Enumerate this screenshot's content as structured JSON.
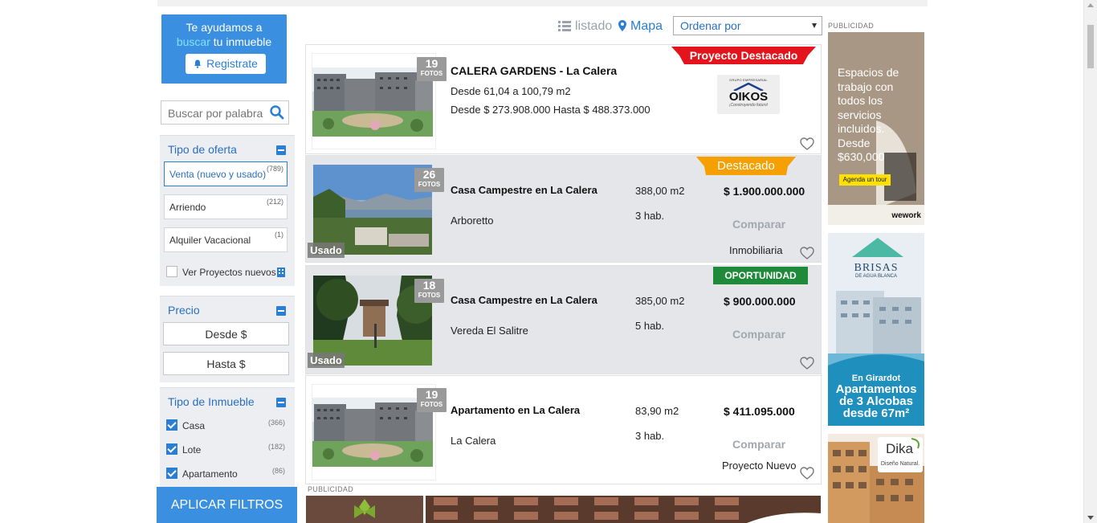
{
  "sidebar": {
    "help_line1": "Te ayudamos a",
    "help_buscar": "buscar",
    "help_rest": " tu inmueble",
    "register_label": "Registrate",
    "search_placeholder": "Buscar por palabra",
    "tipo_oferta": {
      "title": "Tipo de oferta",
      "options": [
        {
          "label": "Venta (nuevo y usado)",
          "count": "(789)",
          "selected": true
        },
        {
          "label": "Arriendo",
          "count": "(212)",
          "selected": false
        },
        {
          "label": "Alquiler Vacacional",
          "count": "(1)",
          "selected": false
        }
      ],
      "proyectos_label": "Ver Proyectos nuevos"
    },
    "precio": {
      "title": "Precio",
      "desde": "Desde $",
      "hasta": "Hasta $"
    },
    "tipo_inmueble": {
      "title": "Tipo de Inmueble",
      "items": [
        {
          "label": "Casa",
          "count": "(366)",
          "checked": true
        },
        {
          "label": "Lote",
          "count": "(182)",
          "checked": true
        },
        {
          "label": "Apartamento",
          "count": "(86)",
          "checked": true
        }
      ]
    },
    "apply_label": "APLICAR FILTROS"
  },
  "toolbar": {
    "listado": "listado",
    "mapa": "Mapa",
    "sort_label": "Ordenar por"
  },
  "listings": [
    {
      "photos": "19",
      "photos_label": "FOTOS",
      "ribbon": "Proyecto Destacado",
      "ribbon_color": "#e3141b",
      "title": "CALERA GARDENS - La Calera",
      "line1": "Desde 61,04 a 100,79 m2",
      "line2": "Desde $ 273.908.000 Hasta $ 488.373.000",
      "logo_text": "OIKOS",
      "logo_top": "GRUPO EMPRESARIAL",
      "logo_tag": "¡Construyendo futuro!"
    },
    {
      "photos": "26",
      "photos_label": "FOTOS",
      "ribbon": "Destacado",
      "ribbon_color": "#f5a000",
      "condition": "Usado",
      "title": "Casa Campestre en La Calera",
      "location": "Arboretto",
      "area": "388,00 m2",
      "rooms": "3 hab.",
      "price": "$ 1.900.000.000",
      "compare": "Comparar",
      "seller": "Inmobiliaria"
    },
    {
      "photos": "18",
      "photos_label": "FOTOS",
      "ribbon": "OPORTUNIDAD",
      "ribbon_color": "#1f8a3a",
      "condition": "Usado",
      "title": "Casa Campestre en La Calera",
      "location": "Vereda El Salitre",
      "area": "385,00 m2",
      "rooms": "5 hab.",
      "price": "$ 900.000.000",
      "compare": "Comparar"
    },
    {
      "photos": "19",
      "photos_label": "FOTOS",
      "title": "Apartamento en La Calera",
      "location": "La Calera",
      "area": "83,90 m2",
      "rooms": "3 hab.",
      "price": "$ 411.095.000",
      "compare": "Comparar",
      "seller": "Proyecto Nuevo"
    }
  ],
  "publicidad_label": "PUBLICIDAD",
  "ads": {
    "wework": {
      "text": "Espacios de trabajo con todos los servicios incluidos. Desde $630,000",
      "cta": "Agenda un tour",
      "brand": "wework"
    },
    "brisas": {
      "name": "BRISAS",
      "sub": "DE AGUA BLANCA",
      "line1": "En Girardot",
      "line2": "Apartamentos",
      "line3": "de 3 Alcobas",
      "line4": "desde 67m²"
    },
    "dika": {
      "brand": "Dika",
      "tagline": "Diseño Natural."
    }
  },
  "colors": {
    "primary": "#3b8fe0",
    "link": "#2a6fc1",
    "ribbon_red": "#e3141b",
    "ribbon_orange": "#f5a000",
    "ribbon_green": "#1f8a3a"
  }
}
